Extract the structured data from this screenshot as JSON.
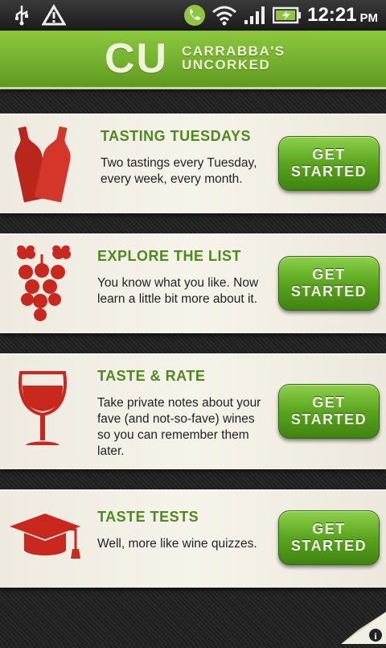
{
  "status_bar": {
    "time": "12:21",
    "ampm": "PM",
    "icons": [
      "usb-icon",
      "warning-icon",
      "phone-icon",
      "wifi-icon",
      "signal-icon",
      "battery-icon"
    ]
  },
  "header": {
    "logo_mark": "CU",
    "logo_line1": "CARRABBA'S",
    "logo_line2": "UNCORKED",
    "color": "#79b532"
  },
  "cards": [
    {
      "title": "TASTING TUESDAYS",
      "description": "Two tastings every Tuesday, every week, every month.",
      "button_line1": "GET",
      "button_line2": "STARTED",
      "icon": "wine-bottles-icon"
    },
    {
      "title": "EXPLORE THE LIST",
      "description": "You know what you like. Now learn a little bit more about it.",
      "button_line1": "GET",
      "button_line2": "STARTED",
      "icon": "grapes-icon"
    },
    {
      "title": "TASTE & RATE",
      "description": "Take private notes about your fave (and not-so-fave) wines so you can remember them later.",
      "button_line1": "GET",
      "button_line2": "STARTED",
      "icon": "wine-glass-icon"
    },
    {
      "title": "TASTE TESTS",
      "description": "Well, more like wine quizzes.",
      "button_line1": "GET",
      "button_line2": "STARTED",
      "icon": "graduation-cap-icon"
    }
  ],
  "colors": {
    "accent_green": "#4f8a1c",
    "button_green": "#5aa51f",
    "icon_red": "#c8281e"
  }
}
